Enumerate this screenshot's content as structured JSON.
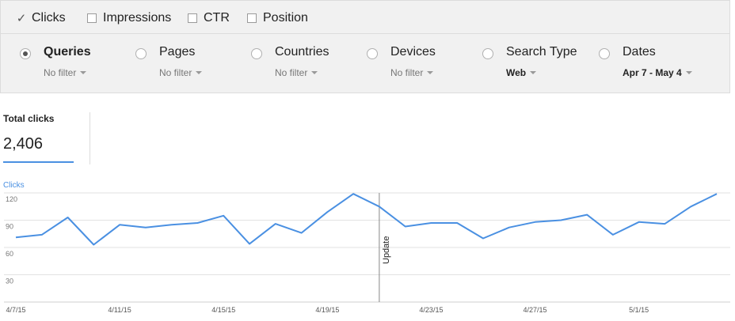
{
  "metrics": [
    {
      "label": "Clicks",
      "checked": true
    },
    {
      "label": "Impressions",
      "checked": false
    },
    {
      "label": "CTR",
      "checked": false
    },
    {
      "label": "Position",
      "checked": false
    }
  ],
  "filters": [
    {
      "label": "Queries",
      "value": "No filter",
      "selected": true
    },
    {
      "label": "Pages",
      "value": "No filter",
      "selected": false
    },
    {
      "label": "Countries",
      "value": "No filter",
      "selected": false
    },
    {
      "label": "Devices",
      "value": "No filter",
      "selected": false
    },
    {
      "label": "Search Type",
      "value": "Web",
      "selected": false
    },
    {
      "label": "Dates",
      "value": "Apr 7 - May 4",
      "selected": false
    }
  ],
  "summary": {
    "label": "Total clicks",
    "value": "2,406"
  },
  "colors": {
    "accent": "#4a90e2",
    "panel": "#f1f1f1",
    "border": "#dcdcdc"
  },
  "chart_data": {
    "type": "line",
    "series": [
      {
        "name": "Clicks",
        "values": [
          71,
          74,
          93,
          63,
          85,
          82,
          85,
          87,
          95,
          64,
          86,
          76,
          99,
          119,
          105,
          83,
          87,
          87,
          70,
          82,
          88,
          90,
          96,
          74,
          88,
          86,
          105,
          119
        ]
      }
    ],
    "x": [
      "4/7/15",
      "4/8/15",
      "4/9/15",
      "4/10/15",
      "4/11/15",
      "4/12/15",
      "4/13/15",
      "4/14/15",
      "4/15/15",
      "4/16/15",
      "4/17/15",
      "4/18/15",
      "4/19/15",
      "4/20/15",
      "4/21/15",
      "4/22/15",
      "4/23/15",
      "4/24/15",
      "4/25/15",
      "4/26/15",
      "4/27/15",
      "4/28/15",
      "4/29/15",
      "4/30/15",
      "5/1/15",
      "5/2/15",
      "5/3/15",
      "5/4/15"
    ],
    "xtick_labels": [
      "4/7/15",
      "4/11/15",
      "4/15/15",
      "4/19/15",
      "4/23/15",
      "4/27/15",
      "5/1/15"
    ],
    "yticks": [
      30,
      60,
      90,
      120
    ],
    "ylim": [
      0,
      120
    ],
    "ylabel": "Clicks",
    "grid": true,
    "annotations": [
      {
        "x": "4/21/15",
        "text": "Update"
      }
    ]
  }
}
